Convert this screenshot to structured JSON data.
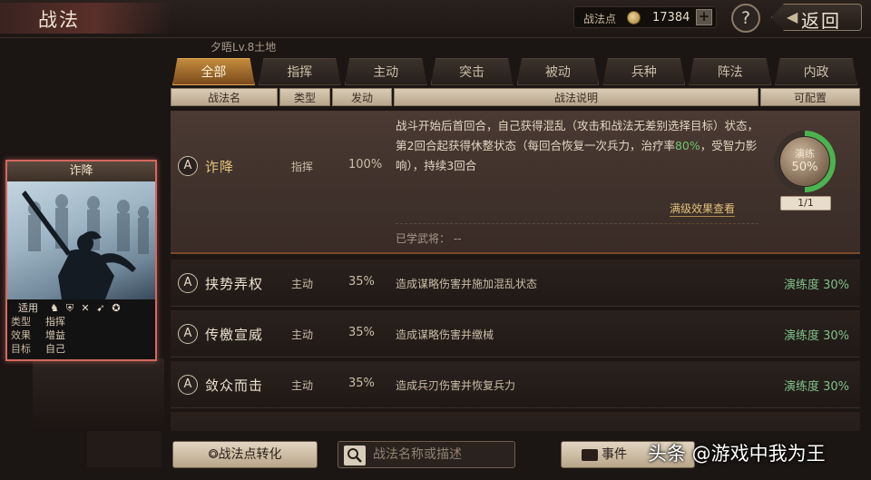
{
  "header": {
    "title": "战法",
    "points_label": "战法点",
    "points_value": "17384",
    "plus": "+",
    "help": "?",
    "back_label": "返回"
  },
  "subtitle": "夕晤Lv.8土地",
  "tabs": [
    "全部",
    "指挥",
    "主动",
    "突击",
    "被动",
    "兵种",
    "阵法",
    "内政"
  ],
  "active_tab": "全部",
  "columns": {
    "name": "战法名",
    "type": "类型",
    "rate": "发动",
    "desc": "战法说明",
    "config": "可配置"
  },
  "selected_skill": {
    "grade": "A",
    "name": "诈降",
    "type": "指挥",
    "rate": "100%",
    "desc_part1": "战斗开始后首回合，自己获得混乱（攻击和战法无差别选择目标）状态，第2回合起获得休整状态（每回合恢复一次兵力，治疗率",
    "desc_heal": "80%",
    "desc_part2": "，受智力影响），持续3回合",
    "full_effect_link": "满级效果查看",
    "learned_label": "已学武将：",
    "learned_value": "--",
    "training_label": "演练",
    "training_pct": "50%",
    "training_fraction": 0.5,
    "slots": "1/1"
  },
  "skills": [
    {
      "grade": "A",
      "name": "挟势弄权",
      "type": "主动",
      "rate": "35%",
      "desc": "造成谋略伤害并施加混乱状态",
      "prof": "演练度 30%"
    },
    {
      "grade": "A",
      "name": "传檄宣威",
      "type": "主动",
      "rate": "35%",
      "desc": "造成谋略伤害并缴械",
      "prof": "演练度 30%"
    },
    {
      "grade": "A",
      "name": "敛众而击",
      "type": "主动",
      "rate": "35%",
      "desc": "造成兵刃伤害并恢复兵力",
      "prof": "演练度 30%"
    }
  ],
  "card": {
    "title": "诈降",
    "applicable_label": "适用",
    "type_label": "类型",
    "type_value": "指挥",
    "effect_label": "效果",
    "effect_value": "增益",
    "target_label": "目标",
    "target_value": "自己",
    "icons": [
      "cavalry-icon",
      "shield-icon",
      "archer-icon",
      "spear-icon",
      "siege-icon"
    ]
  },
  "bottom": {
    "convert_label": "战法点转化",
    "search_placeholder": "战法名称或描述",
    "event_label": "事件"
  },
  "watermark": "头条 @游戏中我为王",
  "colors": {
    "active_tab": "#c28b3c",
    "proficiency": "#7fc089",
    "training_ring": "#4bb34f",
    "card_border": "#d2695f",
    "heal_highlight": "#72c46f"
  }
}
